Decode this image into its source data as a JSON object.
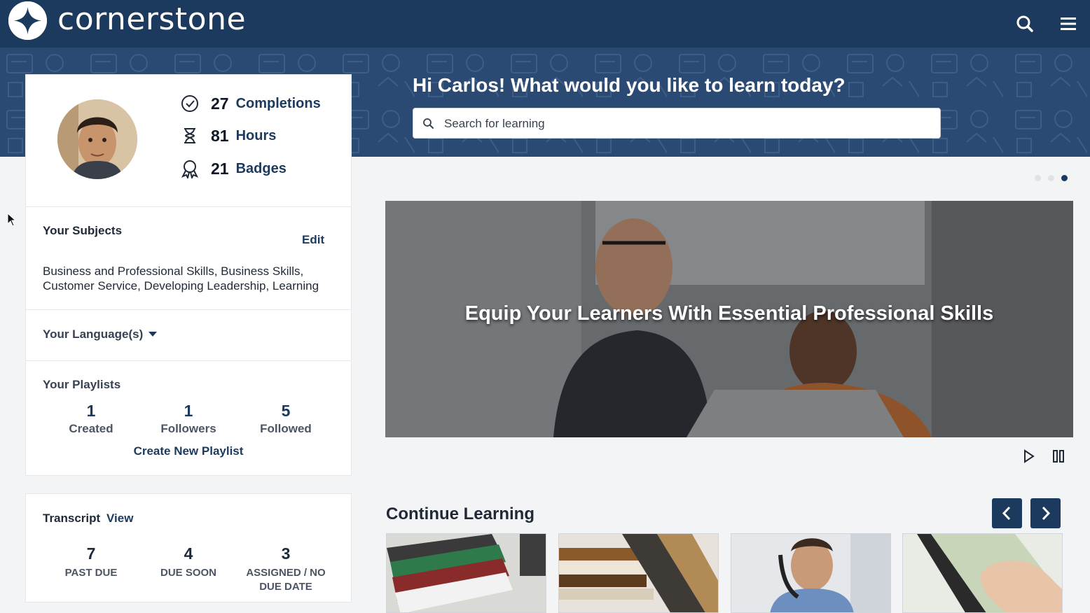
{
  "header": {
    "brand": "cornerstone",
    "icons": {
      "logo": "cornerstone-star-logo",
      "search": "search-icon",
      "menu": "hamburger-menu-icon"
    }
  },
  "banner": {
    "greeting": "Hi Carlos! What would you like to learn today?",
    "search_placeholder": "Search for learning"
  },
  "profile": {
    "stats": [
      {
        "value": "27",
        "label": "Completions",
        "icon": "check-circle-icon"
      },
      {
        "value": "81",
        "label": "Hours",
        "icon": "hourglass-icon"
      },
      {
        "value": "21",
        "label": "Badges",
        "icon": "badge-icon"
      }
    ],
    "subjects": {
      "title": "Your Subjects",
      "edit_label": "Edit",
      "text": "Business and Professional Skills, Business Skills, Customer Service, Developing Leadership, Learning"
    },
    "languages_label": "Your Language(s)",
    "playlists": {
      "title": "Your Playlists",
      "items": [
        {
          "value": "1",
          "label": "Created"
        },
        {
          "value": "1",
          "label": "Followers"
        },
        {
          "value": "5",
          "label": "Followed"
        }
      ],
      "create_label": "Create New Playlist"
    }
  },
  "transcript": {
    "title": "Transcript",
    "view_label": "View",
    "items": [
      {
        "value": "7",
        "label": "PAST DUE"
      },
      {
        "value": "4",
        "label": "DUE SOON"
      },
      {
        "value": "3",
        "label": "ASSIGNED / NO DUE DATE"
      }
    ]
  },
  "carousel": {
    "slide_count": 3,
    "active_slide": 3,
    "caption": "Equip Your Learners With Essential Professional Skills",
    "controls": {
      "play": "play-icon",
      "pause": "pause-icon"
    }
  },
  "continue_learning": {
    "title": "Continue Learning",
    "nav": {
      "prev": "chevron-left-icon",
      "next": "chevron-right-icon"
    },
    "thumbnails": [
      "stacked-binders-image",
      "books-on-shelf-image",
      "man-on-phone-image",
      "hand-on-tablet-image"
    ]
  },
  "colors": {
    "brand_navy": "#1c3a5e",
    "banner": "#2a4a74",
    "page_bg": "#f3f4f6"
  }
}
